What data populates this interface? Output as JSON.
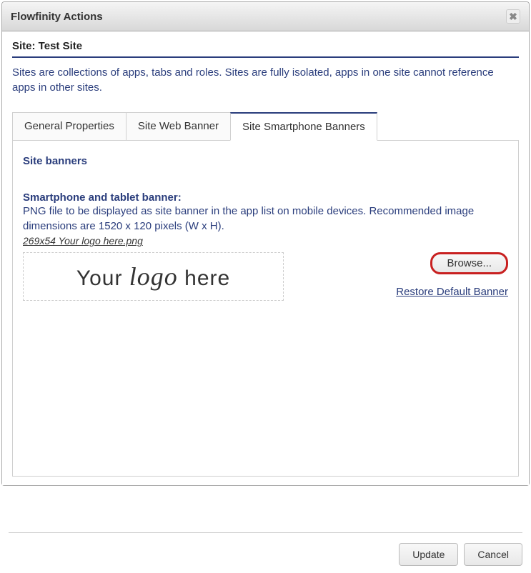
{
  "dialog": {
    "title": "Flowfinity Actions"
  },
  "site": {
    "label": "Site: Test Site",
    "description": "Sites are collections of apps, tabs and roles. Sites are fully isolated, apps in one site cannot reference apps in other sites."
  },
  "tabs": [
    {
      "label": "General Properties"
    },
    {
      "label": "Site Web Banner"
    },
    {
      "label": "Site Smartphone Banners"
    }
  ],
  "panel": {
    "section_title": "Site banners",
    "field_label": "Smartphone and tablet banner:",
    "field_help": "PNG file to be displayed as site banner in the app list on mobile devices. Recommended image dimensions are 1520 x 120 pixels (W x H).",
    "filename": "269x54 Your logo here.png",
    "logo_your": "Your",
    "logo_logo": "logo",
    "logo_here": "here",
    "browse_label": "Browse...",
    "restore_label": "Restore Default Banner"
  },
  "footer": {
    "update": "Update",
    "cancel": "Cancel"
  }
}
